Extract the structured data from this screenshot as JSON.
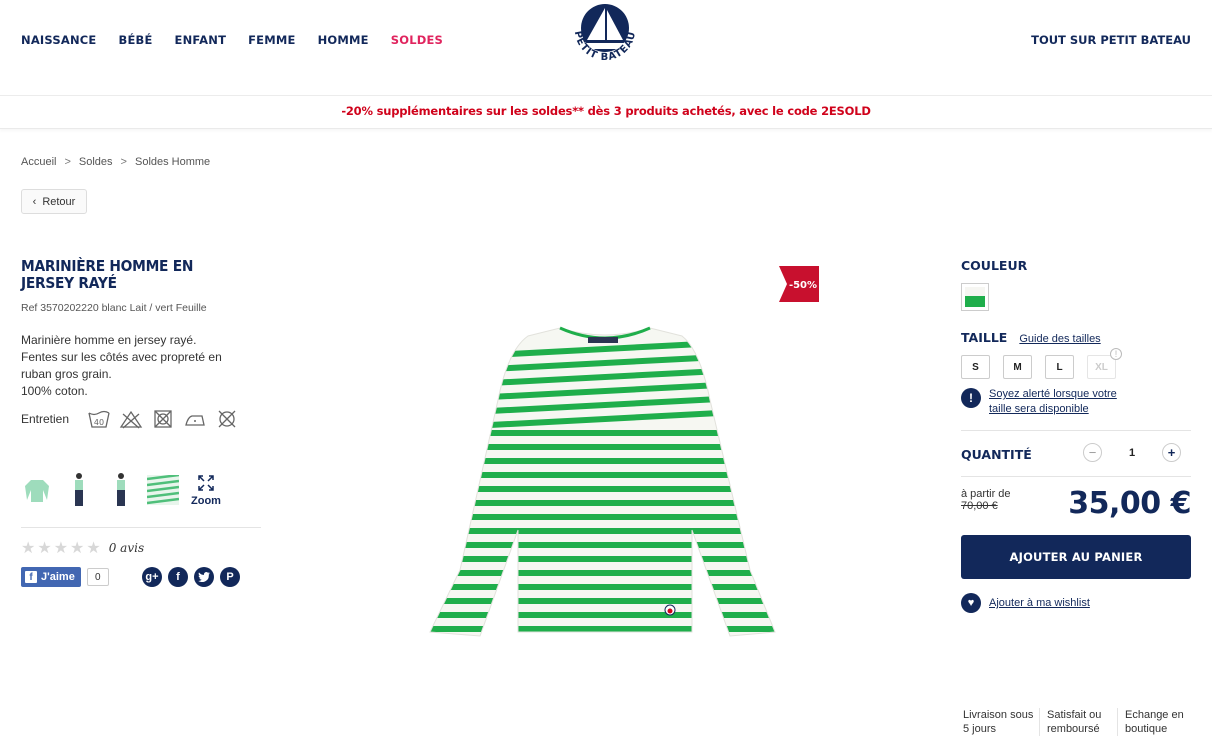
{
  "nav": {
    "items": [
      "NAISSANCE",
      "BÉBÉ",
      "ENFANT",
      "FEMME",
      "HOMME",
      "SOLDES"
    ],
    "right": "TOUT SUR PETIT BATEAU",
    "logo_text": "PETIT BATEAU"
  },
  "promo": "-20% supplémentaires sur les soldes** dès 3 produits achetés, avec le code 2ESOLD",
  "breadcrumb": {
    "items": [
      "Accueil",
      "Soldes",
      "Soldes Homme"
    ],
    "separator": ">"
  },
  "back_label": "Retour",
  "product": {
    "title": "MARINIÈRE HOMME EN JERSEY RAYÉ",
    "ref": "Ref 3570202220 blanc Lait / vert Feuille",
    "description": [
      "Marinière homme en jersey rayé.",
      "Fentes sur les côtés avec propreté en ruban gros grain.",
      "100% coton."
    ],
    "care_label": "Entretien",
    "care_icons": [
      "wash-40-icon",
      "no-bleach-icon",
      "no-tumble-dry-icon",
      "iron-icon",
      "no-dry-clean-icon"
    ],
    "care_wash_temp": "40",
    "zoom_label": "Zoom",
    "discount_badge": "-50%",
    "reviews_count": "0 avis",
    "rating": 0,
    "fb_label": "J'aime",
    "fb_count": "0",
    "social_icons": [
      "google-plus-icon",
      "facebook-icon",
      "twitter-icon",
      "pinterest-icon"
    ]
  },
  "purchase": {
    "color_label": "COULEUR",
    "size_label": "TAILLE",
    "size_guide": "Guide des tailles",
    "sizes": [
      "S",
      "M",
      "L",
      "XL"
    ],
    "alert_text": "Soyez alerté lorsque votre taille sera disponible",
    "quantity_label": "QUANTITÉ",
    "quantity": "1",
    "from_label": "à partir de",
    "old_price": "70,00 €",
    "price": "35,00 €",
    "add_to_cart": "AJOUTER AU PANIER",
    "wishlist": "Ajouter à ma wishlist"
  },
  "features": [
    "Livraison sous 5 jours",
    "Satisfait ou remboursé",
    "Echange en boutique"
  ],
  "colors": {
    "navy": "#12285a",
    "sale": "#e0245e",
    "promo": "#d0021b",
    "stripe": "#1fae4b",
    "badge": "#c8102e"
  }
}
